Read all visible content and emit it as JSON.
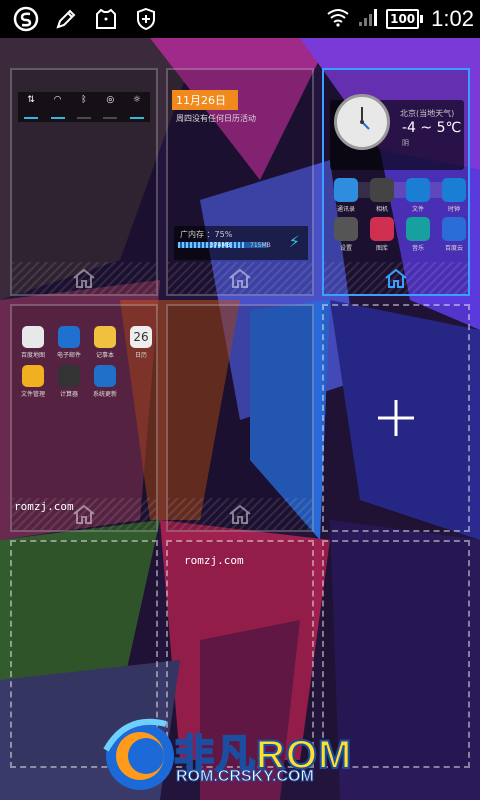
{
  "status_bar": {
    "time": "1:02",
    "battery": "100",
    "icons": [
      "s-logo-icon",
      "pen-icon",
      "tshirt-icon",
      "shield-plus-icon",
      "wifi-icon",
      "signal-icon",
      "battery-icon"
    ]
  },
  "screens": [
    {
      "id": 1,
      "widget": "switch-toggles",
      "active": false
    },
    {
      "id": 2,
      "widget": "calendar-clean",
      "active": false,
      "calendar_date": "11月26日",
      "calendar_note": "周四没有任何日历活动",
      "clean_label": "广内存 ：75%",
      "clean_value": "374MB",
      "clean_value2": "715MB"
    },
    {
      "id": 3,
      "widget": "weather-apps",
      "active": true,
      "weather_city": "北京(当地天气)",
      "weather_temp": "-4 ~ 5℃",
      "weather_desc": "阴"
    },
    {
      "id": 4,
      "widget": "app-folder",
      "active": false,
      "footer_text": "romzj.com"
    },
    {
      "id": 5,
      "widget": "empty",
      "active": false
    },
    {
      "id": 6,
      "widget": "add",
      "active": false
    },
    {
      "id": 7,
      "widget": "empty-dashed",
      "active": false
    },
    {
      "id": 8,
      "widget": "empty-dashed",
      "active": false,
      "top_text": "romzj.com"
    },
    {
      "id": 9,
      "widget": "empty-dashed",
      "active": false
    }
  ],
  "screen3_apps": [
    {
      "label": "通讯录",
      "color": "#2f8de0",
      "icon": "contacts-icon"
    },
    {
      "label": "相机",
      "color": "#444",
      "icon": "camera-icon"
    },
    {
      "label": "文件",
      "color": "#1a7fd4",
      "icon": "files-icon"
    },
    {
      "label": "时钟",
      "color": "#1a7fd4",
      "icon": "clock-icon"
    },
    {
      "label": "设置",
      "color": "#555",
      "icon": "settings-icon"
    },
    {
      "label": "图库",
      "color": "#d03050",
      "icon": "gallery-icon"
    },
    {
      "label": "音乐",
      "color": "#18a0a0",
      "icon": "music-icon"
    },
    {
      "label": "百度云",
      "color": "#2a6cd8",
      "icon": "cloud-icon"
    }
  ],
  "screen4_apps": [
    {
      "label": "百度地图",
      "color": "#e8e8e8",
      "icon": "map-icon"
    },
    {
      "label": "电子邮件",
      "color": "#2070d0",
      "icon": "email-icon"
    },
    {
      "label": "记事本",
      "color": "#f0c040",
      "icon": "notes-icon"
    },
    {
      "label": "日历",
      "color": "#eeeeee",
      "icon": "calendar-icon",
      "text": "26"
    },
    {
      "label": "文件管理",
      "color": "#f0b020",
      "icon": "folder-icon"
    },
    {
      "label": "计算器",
      "color": "#333",
      "icon": "calculator-icon"
    },
    {
      "label": "系统更新",
      "color": "#1e70c8",
      "icon": "update-icon"
    }
  ],
  "brand": {
    "title": "非凡ROM",
    "subtitle": "ROM.CRSKY.COM"
  }
}
